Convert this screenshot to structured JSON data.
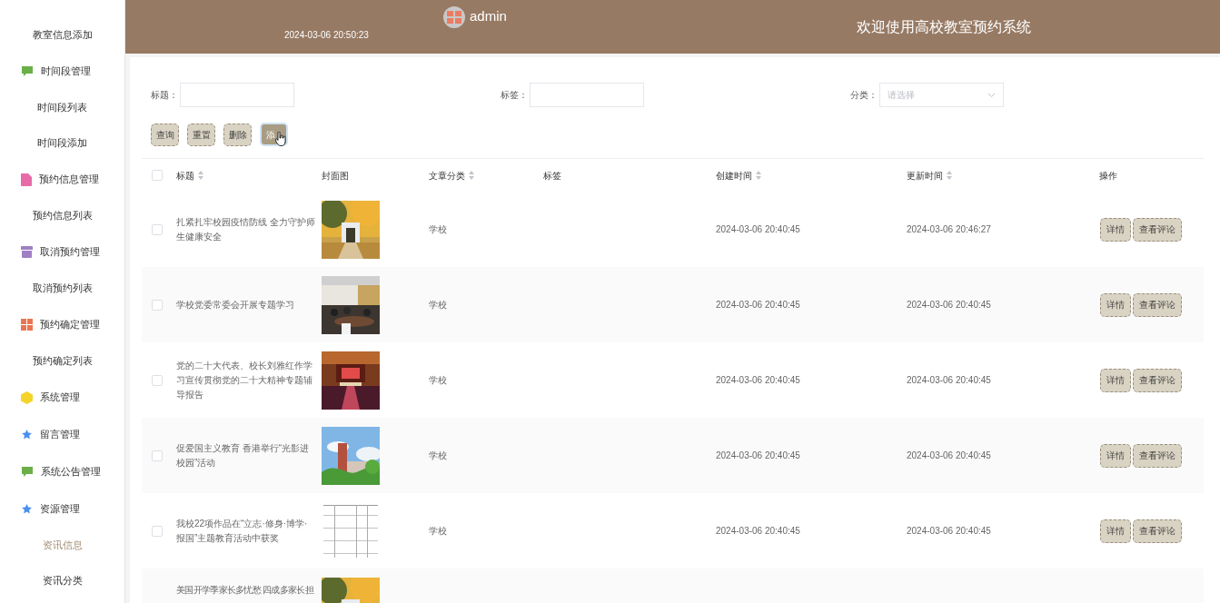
{
  "sidebar": {
    "items": [
      {
        "kind": "item",
        "label": "教室信息添加",
        "selected": false
      },
      {
        "kind": "chat",
        "label": "时间段管理",
        "color": "#6aaf48"
      },
      {
        "kind": "item",
        "label": "时间段列表",
        "selected": false
      },
      {
        "kind": "item",
        "label": "时间段添加",
        "selected": false
      },
      {
        "kind": "document",
        "label": "预约信息管理",
        "color": "#e86aa6"
      },
      {
        "kind": "item",
        "label": "预约信息列表",
        "selected": false
      },
      {
        "kind": "archive",
        "label": "取消预约管理",
        "color": "#a07fc4"
      },
      {
        "kind": "item",
        "label": "取消预约列表",
        "selected": false
      },
      {
        "kind": "grid",
        "label": "预约确定管理",
        "color": "#ea7650"
      },
      {
        "kind": "item",
        "label": "预约确定列表",
        "selected": false
      },
      {
        "kind": "cube",
        "label": "系统管理",
        "color": "#f5d42a"
      },
      {
        "kind": "star",
        "label": "留言管理",
        "color": "#4a8ff0"
      },
      {
        "kind": "chat",
        "label": "系统公告管理",
        "color": "#6aaf48"
      },
      {
        "kind": "star",
        "label": "资源管理",
        "color": "#4a8ff0"
      },
      {
        "kind": "item",
        "label": "资讯信息",
        "selected": true
      },
      {
        "kind": "item",
        "label": "资讯分类",
        "selected": false
      }
    ]
  },
  "header": {
    "datetime": "2024-03-06 20:50:23",
    "user": "admin",
    "title": "欢迎使用高校教室预约系统"
  },
  "filters": [
    {
      "label": "标题：",
      "kind": "input"
    },
    {
      "label": "标签：",
      "kind": "input"
    },
    {
      "label": "分类：",
      "kind": "select",
      "placeholder": "请选择"
    }
  ],
  "actions": [
    {
      "label": "查询",
      "hover": false
    },
    {
      "label": "重置",
      "hover": false
    },
    {
      "label": "删除",
      "hover": false
    },
    {
      "label": "添",
      "hover": true
    }
  ],
  "table": {
    "select_all_checked": false,
    "columns": [
      {
        "label": "标题",
        "sortable": true
      },
      {
        "label": "封面图",
        "sortable": false
      },
      {
        "label": "文章分类",
        "sortable": true
      },
      {
        "label": "标签",
        "sortable": false
      },
      {
        "label": "创建时间",
        "sortable": true
      },
      {
        "label": "更新时间",
        "sortable": true
      },
      {
        "label": "操作",
        "sortable": false
      }
    ],
    "rows": [
      {
        "checked": false,
        "title": "扎紧扎牢校园疫情防线 全力守护师生健康安全",
        "category": "学校",
        "created": "2024-03-06 20:40:45",
        "updated": "2024-03-06 20:46:27",
        "buttons": [
          "详情",
          "查看评论"
        ]
      },
      {
        "checked": false,
        "title": "学校党委常委会开展专题学习",
        "category": "学校",
        "created": "2024-03-06 20:40:45",
        "updated": "2024-03-06 20:40:45",
        "buttons": [
          "详情",
          "查看评论"
        ]
      },
      {
        "checked": false,
        "title": "党的二十大代表、校长刘雅红作学习宣传贯彻党的二十大精神专题辅导报告",
        "category": "学校",
        "created": "2024-03-06 20:40:45",
        "updated": "2024-03-06 20:40:45",
        "buttons": [
          "详情",
          "查看评论"
        ]
      },
      {
        "checked": false,
        "title": "促爱国主义教育 香港举行“光影进校园”活动",
        "category": "学校",
        "created": "2024-03-06 20:40:45",
        "updated": "2024-03-06 20:40:45",
        "buttons": [
          "详情",
          "查看评论"
        ]
      },
      {
        "checked": false,
        "title": "我校22项作品在“立志·修身·博学·报国”主题教育活动中获奖",
        "category": "学校",
        "created": "2024-03-06 20:40:45",
        "updated": "2024-03-06 20:40:45",
        "buttons": [
          "详情",
          "查看评论"
        ]
      },
      {
        "title": "美国开学季家长多忧愁 四成多家长担"
      }
    ]
  }
}
